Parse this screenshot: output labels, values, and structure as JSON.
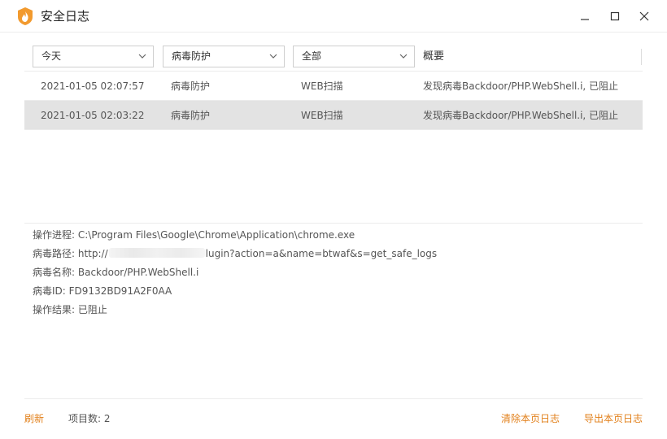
{
  "window": {
    "title": "安全日志",
    "icon": "flame-logo-icon",
    "accent_color": "#f29a2e"
  },
  "filters": {
    "date": "今天",
    "category": "病毒防护",
    "subtype": "全部",
    "summary_header": "概要"
  },
  "rows": [
    {
      "time": "2021-01-05 02:07:57",
      "type": "病毒防护",
      "sub": "WEB扫描",
      "desc": "发现病毒Backdoor/PHP.WebShell.i, 已阻止"
    },
    {
      "time": "2021-01-05 02:03:22",
      "type": "病毒防护",
      "sub": "WEB扫描",
      "desc": "发现病毒Backdoor/PHP.WebShell.i, 已阻止"
    }
  ],
  "details": {
    "process_label": "操作进程:",
    "process_value": "C:\\Program Files\\Google\\Chrome\\Application\\chrome.exe",
    "path_label": "病毒路径:",
    "path_prefix": "http://",
    "path_suffix": "lugin?action=a&name=btwaf&s=get_safe_logs",
    "name_label": "病毒名称:",
    "name_value": "Backdoor/PHP.WebShell.i",
    "id_label": "病毒ID:",
    "id_value": "FD9132BD91A2F0AA",
    "result_label": "操作结果:",
    "result_value": "已阻止"
  },
  "footer": {
    "refresh": "刷新",
    "count_label": "项目数:",
    "count_value": "2",
    "clear": "清除本页日志",
    "export": "导出本页日志",
    "link_color": "#e2811c"
  }
}
